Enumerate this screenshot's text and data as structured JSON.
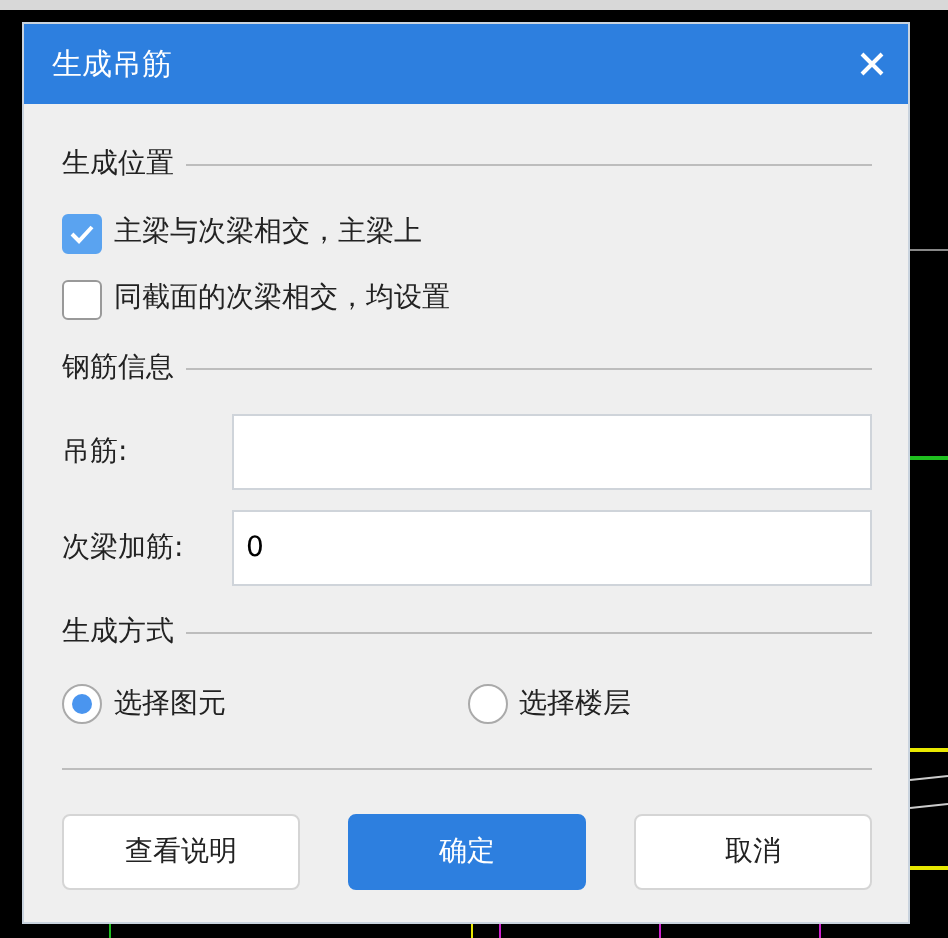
{
  "window": {
    "title": "生成吊筋"
  },
  "sections": [
    {
      "heading": "生成位置",
      "kind": "checks",
      "items": [
        {
          "label": "主梁与次梁相交，主梁上",
          "checked": true
        },
        {
          "label": "同截面的次梁相交，均设置",
          "checked": false
        }
      ]
    },
    {
      "heading": "钢筋信息",
      "kind": "fields",
      "items": [
        {
          "label": "吊筋:"
        },
        {
          "label": "次梁加筋:",
          "value": "0"
        }
      ]
    },
    {
      "heading": "生成方式",
      "kind": "radios",
      "items": [
        {
          "label": "选择图元",
          "selected": true
        },
        {
          "label": "选择楼层",
          "selected": false
        }
      ]
    }
  ],
  "buttons": [
    {
      "label": "查看说明",
      "kind": "default"
    },
    {
      "label": "确定",
      "kind": "primary"
    },
    {
      "label": "取消",
      "kind": "default"
    }
  ]
}
